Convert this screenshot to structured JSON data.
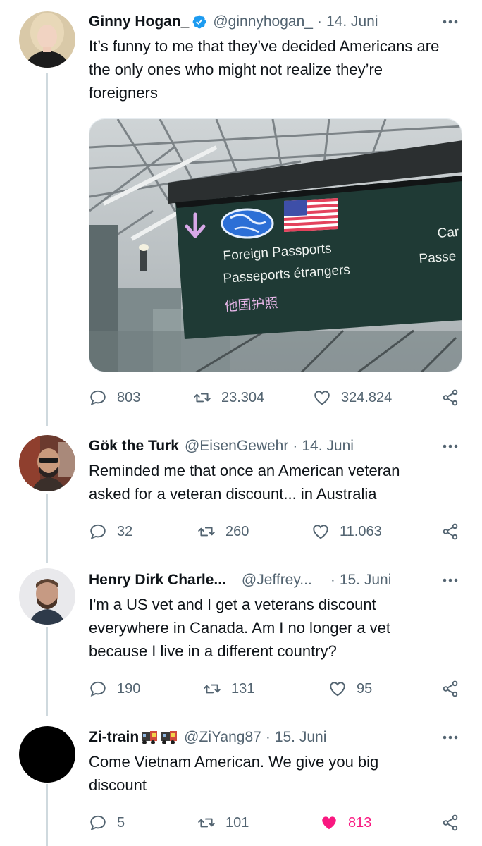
{
  "tweets": [
    {
      "name": "Ginny Hogan_",
      "handle": "@ginnyhogan_",
      "separator": "·",
      "date": "14. Juni",
      "text": "It’s funny to me that they’ve decided Americans are the only ones who might not realize they’re foreigners",
      "replies": "803",
      "retweets": "23.304",
      "likes": "324.824",
      "verified": true,
      "image": {
        "sign_line1": "Foreign Passports",
        "sign_line2": "Passeports étrangers",
        "sign_line3": "他国护照",
        "sign_side1": "Car",
        "sign_side2": "Passe"
      }
    },
    {
      "name": "Gök the Turk",
      "handle": "@EisenGewehr",
      "separator": "·",
      "date": "14. Juni",
      "text": "Reminded me that once an American veteran asked for a veteran discount... in Australia",
      "replies": "32",
      "retweets": "260",
      "likes": "11.063"
    },
    {
      "name": "Henry Dirk Charle...",
      "handle": "@Jeffrey...",
      "separator": "·",
      "date": "15. Juni",
      "text": "I'm a US vet and I get a veterans discount everywhere in Canada. Am I no longer a vet because I live in a different country?",
      "replies": "190",
      "retweets": "131",
      "likes": "95"
    },
    {
      "name": "Zi-train",
      "handle": "@ZiYang87",
      "separator": "·",
      "date": "15. Juni",
      "text": "Come Vietnam American. We give you big discount",
      "replies": "5",
      "retweets": "101",
      "likes": "813",
      "liked": true,
      "name_emojis": [
        "train-emoji",
        "train-emoji"
      ]
    }
  ],
  "colors": {
    "text": "#0f1419",
    "secondary": "#536471",
    "verified": "#1d9bf0",
    "like_active": "#f91880",
    "thread_line": "#cfd9de"
  }
}
